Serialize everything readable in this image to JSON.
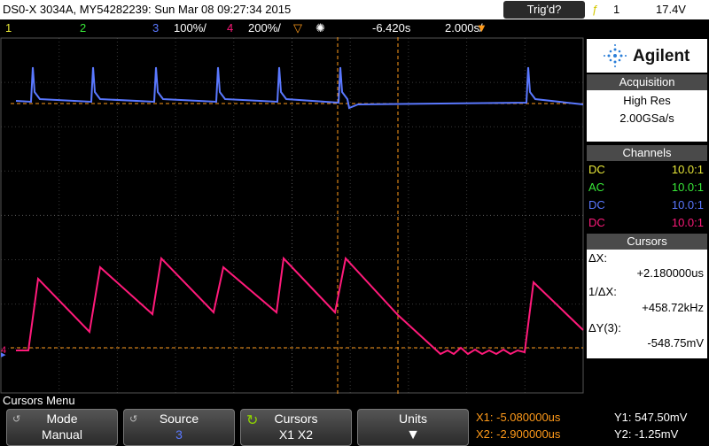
{
  "title_bar": {
    "model_serial_date": "DS0-X 3034A, MY54282239: Sun Mar 08 09:27:34 2015",
    "trig_channel": "1",
    "trig_level": "17.4V"
  },
  "status_bar": {
    "ch1_label": "1",
    "ch2_label": "2",
    "ch3_label": "3",
    "ch3_scale": "100%/",
    "ch4_label": "4",
    "ch4_scale": "200%/",
    "time_offset": "-6.420s",
    "time_scale": "2.000s/",
    "trig_status": "Trig'd?"
  },
  "brand": {
    "name": "Agilent"
  },
  "acquisition": {
    "title": "Acquisition",
    "mode": "High Res",
    "rate": "2.00GSa/s"
  },
  "channels": {
    "title": "Channels",
    "rows": [
      {
        "coupling": "DC",
        "probe": "10.0:1",
        "color": "#e8e838"
      },
      {
        "coupling": "AC",
        "probe": "10.0:1",
        "color": "#38e838"
      },
      {
        "coupling": "DC",
        "probe": "10.0:1",
        "color": "#5a78ff"
      },
      {
        "coupling": "DC",
        "probe": "10.0:1",
        "color": "#ff1a7a"
      }
    ]
  },
  "cursors": {
    "title": "Cursors",
    "dx_label": "ΔX:",
    "dx_value": "+2.180000us",
    "inv_dx_label": "1/ΔX:",
    "inv_dx_value": "+458.72kHz",
    "dy_label": "ΔY(3):",
    "dy_value": "-548.75mV"
  },
  "menu": {
    "title": "Cursors Menu",
    "softkeys": [
      {
        "label": "Mode",
        "value": "Manual"
      },
      {
        "label": "Source",
        "value": "3"
      },
      {
        "label": "Cursors",
        "value": "X1 X2"
      },
      {
        "label": "Units",
        "value": ""
      }
    ]
  },
  "cursor_readout": {
    "x1": "X1: -5.080000us",
    "x2": "X2: -2.900000us",
    "y1": "Y1: 547.50mV",
    "y2": "Y2: -1.25mV"
  },
  "colors": {
    "ch1": "#e8e838",
    "ch2": "#38e838",
    "ch3": "#5a78ff",
    "ch4": "#ff1a7a",
    "cursor": "#ff9a1a",
    "grid": "#3a3a3a"
  }
}
